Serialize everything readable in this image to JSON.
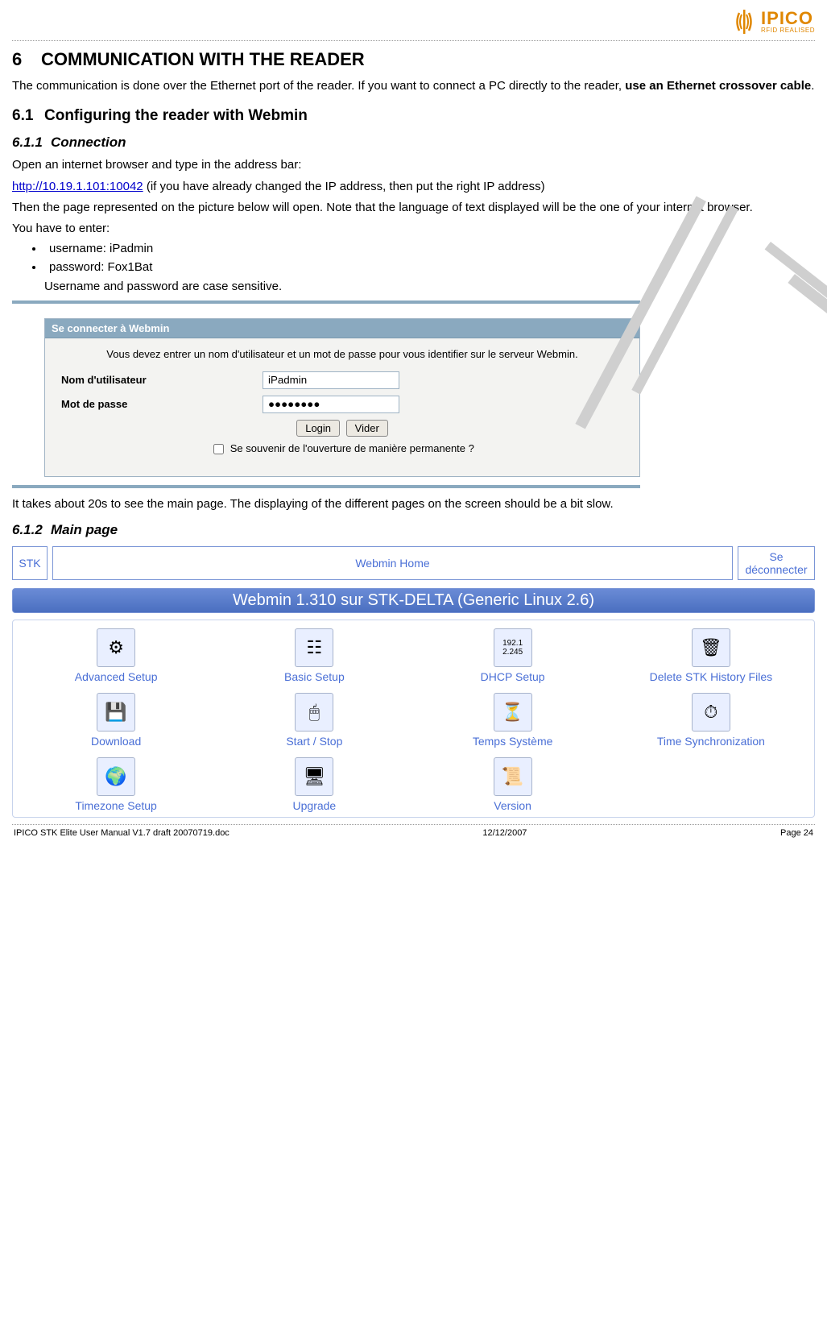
{
  "logo": {
    "main": "IPICO",
    "sub": "RFID REALISED"
  },
  "h1": {
    "num": "6",
    "title": "COMMUNICATION WITH THE READER"
  },
  "intro1": "The communication is done over the Ethernet port of the reader. If you want to connect a PC directly to the reader, ",
  "intro1_bold": "use an Ethernet crossover cable",
  "intro1_end": ".",
  "h2": {
    "num": "6.1",
    "title": "Configuring the reader with Webmin"
  },
  "h3a": {
    "num": "6.1.1",
    "title": "Connection"
  },
  "p_open": "Open an internet browser and type in the address bar:",
  "url": "http://10.19.1.101:10042",
  "url_after": "  (if you have already changed the IP address, then put the right IP address)",
  "p_then": "Then the page represented on the picture below will open. Note that the language of text displayed will be the one of your internet browser.",
  "p_enter": "You have to enter:",
  "cred_user": "username: iPadmin",
  "cred_pass": "password: Fox1Bat",
  "cred_note": "Username and password are case sensitive.",
  "login": {
    "title": "Se connecter à Webmin",
    "msg": "Vous devez entrer un nom d'utilisateur et un mot de passe pour vous identifier sur le serveur Webmin.",
    "user_label": "Nom d'utilisateur",
    "pass_label": "Mot de passe",
    "user_value": "iPadmin",
    "pass_value_display": "●●●●●●●●",
    "btn_login": "Login",
    "btn_clear": "Vider",
    "remember": "Se souvenir de l'ouverture de manière permanente ?"
  },
  "p_after_login": "It takes about 20s to see the main page. The displaying of the different pages on the screen should be a bit slow.",
  "h3b": {
    "num": "6.1.2",
    "title": "Main page"
  },
  "webmin": {
    "stk": "STK",
    "home": "Webmin Home",
    "logout": "Se déconnecter",
    "title": "Webmin 1.310 sur STK-DELTA (Generic Linux 2.6)",
    "items": [
      {
        "label": "Advanced Setup",
        "icon": "⚙"
      },
      {
        "label": "Basic Setup",
        "icon": "☷"
      },
      {
        "label": "DHCP Setup",
        "icon": "192.1 2.245"
      },
      {
        "label": "Delete STK History Files",
        "icon": "🗑"
      },
      {
        "label": "Download",
        "icon": "💾"
      },
      {
        "label": "Start / Stop",
        "icon": "🖱"
      },
      {
        "label": "Temps Système",
        "icon": "⏳"
      },
      {
        "label": "Time Synchronization",
        "icon": "⏱"
      },
      {
        "label": "Timezone Setup",
        "icon": "🌍"
      },
      {
        "label": "Upgrade",
        "icon": "🖥"
      },
      {
        "label": "Version",
        "icon": "📜"
      }
    ]
  },
  "footer": {
    "left": "IPICO STK Elite User Manual V1.7 draft 20070719.doc",
    "center": "12/12/2007",
    "right": "Page 24"
  }
}
